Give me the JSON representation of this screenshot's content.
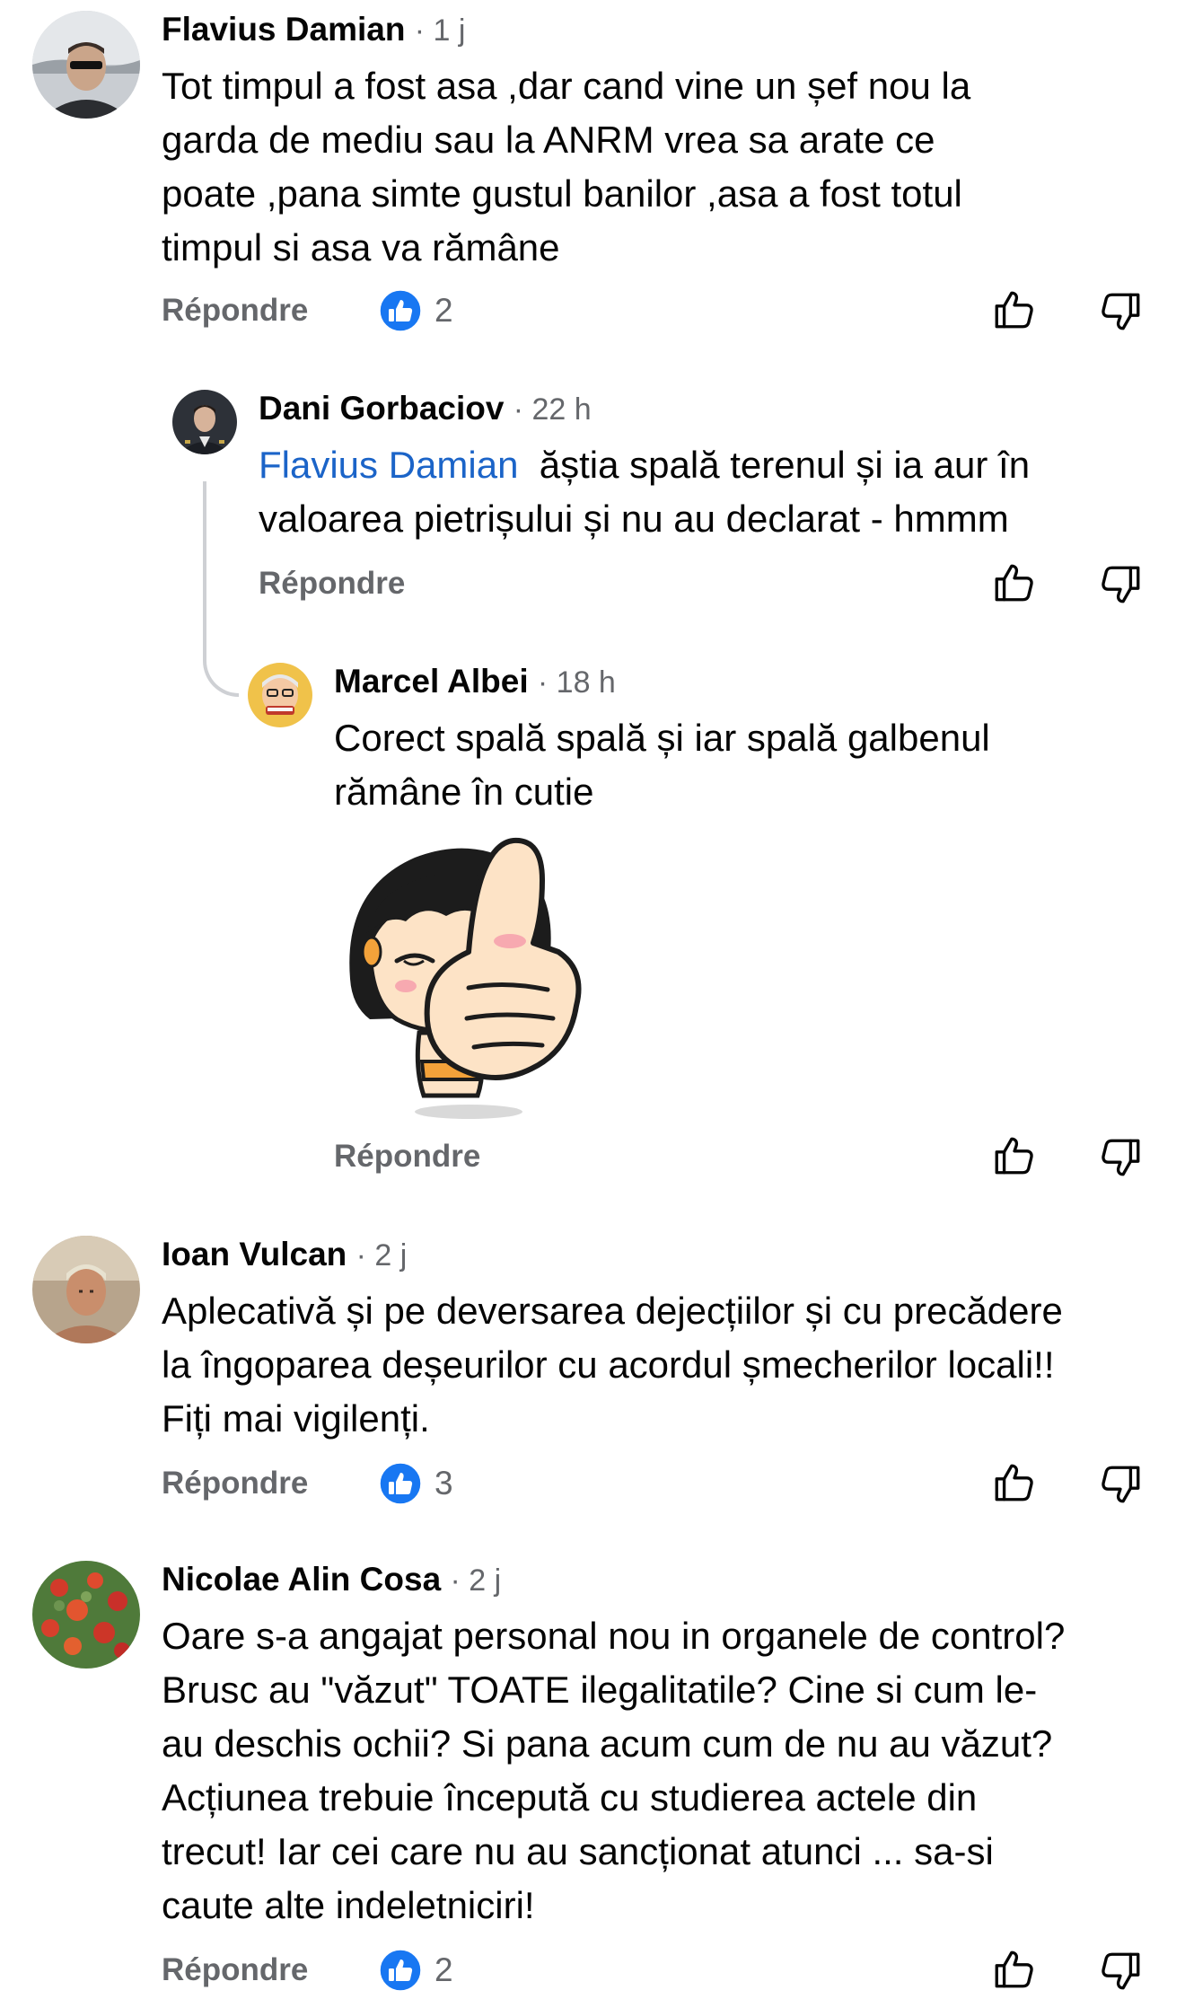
{
  "comments": [
    {
      "author": "Flavius Damian",
      "time": "· 1 j",
      "lines": [
        "Tot timpul a fost asa ,dar cand vine un șef nou la",
        "garda de mediu sau la ANRM vrea sa arate ce",
        "poate ,pana simte gustul banilor ,asa a fost totul",
        "timpul si asa va rămâne"
      ],
      "reply_label": "Répondre",
      "likes": "2"
    },
    {
      "author": "Dani Gorbaciov",
      "time": "· 22 h",
      "mention": "Flavius Damian",
      "line1_rest": "  ăștia spală terenul și ia aur în",
      "line2": "valoarea pietrișului și nu au declarat - hmmm",
      "reply_label": "Répondre"
    },
    {
      "author": "Marcel Albei",
      "time": "· 18 h",
      "lines": [
        "Corect spală spală și iar spală galbenul",
        "rămâne în cutie"
      ],
      "reply_label": "Répondre",
      "sticker": "thumbs-up-girl-sticker"
    },
    {
      "author": "Ioan Vulcan",
      "time": "· 2 j",
      "lines": [
        "Aplecativă și pe deversarea dejecțiilor și cu precădere",
        "la îngoparea deșeurilor cu acordul șmecherilor locali!!",
        "Fiți mai vigilenți."
      ],
      "reply_label": "Répondre",
      "likes": "3"
    },
    {
      "author": "Nicolae Alin Cosa",
      "time": "· 2 j",
      "lines": [
        "Oare s-a angajat personal nou in organele de control?",
        "Brusc au \"văzut\" TOATE ilegalitatile? Cine si cum le-",
        "au deschis ochii? Si pana acum cum de nu au văzut?",
        "Acțiunea trebuie începută cu studierea actele din",
        "trecut! Iar cei care nu au sancționat atunci ... sa-si",
        "caute alte indeletniciri!"
      ],
      "reply_label": "Répondre",
      "likes": "2"
    }
  ],
  "icons": {
    "like_badge": "like-reaction-icon",
    "thumb_up": "thumbs-up-icon",
    "thumb_down": "thumbs-down-icon"
  },
  "colors": {
    "mention": "#1b64c8",
    "meta_gray": "#65676b",
    "like_blue": "#1877f2",
    "thread_line": "#ced0d4"
  }
}
